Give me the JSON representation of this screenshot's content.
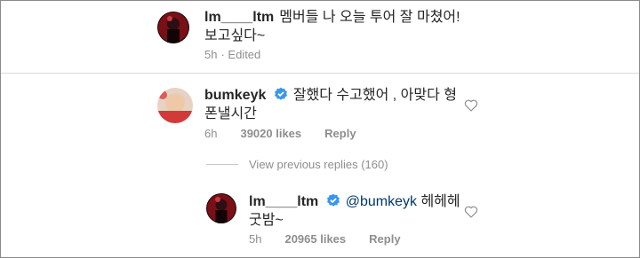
{
  "comments": [
    {
      "username": "lm____ltm",
      "text_line1": "멤버들 나 오늘 투어 잘 마쳤어!",
      "text_line2": "보고싶다~",
      "time": "5h",
      "edited": "· Edited"
    },
    {
      "username": "bumkeyk",
      "text_line1": "잘했다 수고했어 , 아맞다 형",
      "text_line2": "폰낼시간",
      "time": "6h",
      "likes": "39020 likes",
      "reply": "Reply"
    }
  ],
  "view_replies": "View previous replies (160)",
  "reply": {
    "username": "lm____ltm",
    "mention": "@bumkeyk",
    "text_line1": "헤헤헤",
    "text_line2": "굿밤~",
    "time": "5h",
    "likes": "20965 likes",
    "reply": "Reply"
  },
  "colors": {
    "verified": "#3897f0",
    "muted": "#8e8e8e",
    "mention": "#00376b"
  }
}
